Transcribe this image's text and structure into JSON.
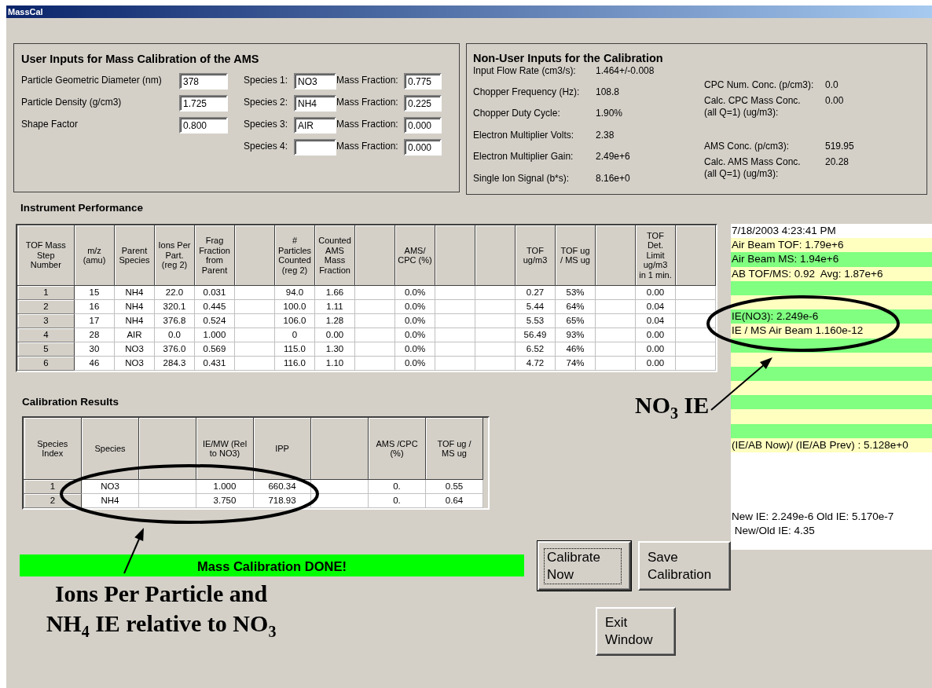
{
  "window": {
    "title": "MassCal"
  },
  "user_inputs": {
    "title": "User Inputs for Mass Calibration of the AMS",
    "particle_fields": [
      {
        "label": "Particle Geometric Diameter (nm)",
        "value": "378"
      },
      {
        "label": "Particle Density (g/cm3)",
        "value": "1.725"
      },
      {
        "label": "Shape Factor",
        "value": "0.800"
      }
    ],
    "species": [
      {
        "label": "Species 1:",
        "value": "NO3",
        "fraction_label": "Mass Fraction:",
        "fraction": "0.775"
      },
      {
        "label": "Species 2:",
        "value": "NH4",
        "fraction_label": "Mass Fraction:",
        "fraction": "0.225"
      },
      {
        "label": "Species 3:",
        "value": "AIR",
        "fraction_label": "Mass Fraction:",
        "fraction": "0.000"
      },
      {
        "label": "Species 4:",
        "fraction_label": "Mass Fraction:",
        "fraction": "0.000"
      }
    ]
  },
  "non_user_inputs": {
    "title": "Non-User Inputs for the Calibration",
    "left": [
      {
        "label": "Input Flow Rate (cm3/s):",
        "value": "1.464+/-0.008"
      },
      {
        "label": "Chopper Frequency (Hz):",
        "value": "108.8"
      },
      {
        "label": "Chopper Duty Cycle:",
        "value": "1.90%"
      },
      {
        "label": "Electron Multiplier Volts:",
        "value": "2.38"
      },
      {
        "label": "Electron Multiplier Gain:",
        "value": "2.49e+6"
      },
      {
        "label": "Single Ion Signal (b*s):",
        "value": "8.16e+0"
      }
    ],
    "right": [
      {
        "label": "CPC Num. Conc. (p/cm3):",
        "value": "0.0"
      },
      {
        "label": "Calc. CPC Mass Conc.\n(all Q=1) (ug/m3):",
        "value": "0.00"
      },
      {
        "label": "AMS Conc. (p/cm3):",
        "value": "519.95"
      },
      {
        "label": "Calc. AMS Mass Conc.\n(all Q=1) (ug/m3):",
        "value": "20.28"
      }
    ]
  },
  "instrument_performance": {
    "title": "Instrument Performance",
    "columns": [
      "TOF Mass\nStep\nNumber",
      "m/z\n(amu)",
      "Parent\nSpecies",
      "Ions Per\nPart.\n(reg 2)",
      "Frag\nFraction\nfrom\nParent",
      null,
      "#\nParticles\nCounted\n(reg 2)",
      "Counted\nAMS\nMass\nFraction",
      null,
      "AMS/\nCPC (%)",
      null,
      null,
      "TOF\nug/m3",
      "TOF ug\n/ MS ug",
      null,
      "TOF\nDet.\nLimit\nug/m3\nin 1 min.",
      null
    ],
    "rows": [
      [
        "1",
        "15",
        "NH4",
        "22.0",
        "0.031",
        null,
        "94.0",
        "1.66",
        null,
        "0.0%",
        null,
        null,
        "0.27",
        "53%",
        null,
        "0.00",
        null
      ],
      [
        "2",
        "16",
        "NH4",
        "320.1",
        "0.445",
        null,
        "100.0",
        "1.11",
        null,
        "0.0%",
        null,
        null,
        "5.44",
        "64%",
        null,
        "0.04",
        null
      ],
      [
        "3",
        "17",
        "NH4",
        "376.8",
        "0.524",
        null,
        "106.0",
        "1.28",
        null,
        "0.0%",
        null,
        null,
        "5.53",
        "65%",
        null,
        "0.04",
        null
      ],
      [
        "4",
        "28",
        "AIR",
        "0.0",
        "1.000",
        null,
        "0",
        "0.00",
        null,
        "0.0%",
        null,
        null,
        "56.49",
        "93%",
        null,
        "0.00",
        null
      ],
      [
        "5",
        "30",
        "NO3",
        "376.0",
        "0.569",
        null,
        "115.0",
        "1.30",
        null,
        "0.0%",
        null,
        null,
        "6.52",
        "46%",
        null,
        "0.00",
        null
      ],
      [
        "6",
        "46",
        "NO3",
        "284.3",
        "0.431",
        null,
        "116.0",
        "1.10",
        null,
        "0.0%",
        null,
        null,
        "4.72",
        "74%",
        null,
        "0.00",
        null
      ]
    ]
  },
  "calibration_results": {
    "title": "Calibration Results",
    "columns": [
      "Species\nIndex",
      "Species",
      null,
      "IE/MW (Rel\nto NO3)",
      "IPP",
      null,
      "AMS /CPC\n(%)",
      "TOF ug /\nMS ug"
    ],
    "rows": [
      [
        "1",
        "NO3",
        null,
        "1.000",
        "660.34",
        null,
        "0.",
        "0.55"
      ],
      [
        "2",
        "NH4",
        null,
        "3.750",
        "718.93",
        null,
        "0.",
        "0.64"
      ]
    ]
  },
  "status": {
    "text": "Mass Calibration DONE!"
  },
  "buttons": [
    {
      "label": "Calibrate Now",
      "default": true
    },
    {
      "label": "Save Calibration",
      "default": false
    },
    {
      "label": "Exit Window",
      "default": false
    }
  ],
  "log": {
    "lines": [
      {
        "kind": "plain",
        "text": "7/18/2003 4:23:41 PM"
      },
      {
        "kind": "striped",
        "text": "Air Beam TOF: 1.79e+6"
      },
      {
        "kind": "striped",
        "text": "Air Beam MS: 1.94e+6"
      },
      {
        "kind": "striped",
        "text": "AB TOF/MS: 0.92  Avg: 1.87e+6"
      },
      {
        "kind": "striped"
      },
      {
        "kind": "striped"
      },
      {
        "kind": "striped",
        "text": "IE(NO3): 2.249e-6"
      },
      {
        "kind": "striped",
        "text": "IE / MS Air Beam 1.160e-12"
      },
      {
        "kind": "striped"
      },
      {
        "kind": "striped"
      },
      {
        "kind": "striped"
      },
      {
        "kind": "striped"
      },
      {
        "kind": "striped"
      },
      {
        "kind": "striped"
      },
      {
        "kind": "striped"
      },
      {
        "kind": "striped",
        "text": "(IE/AB Now)/ (IE/AB Prev) : 5.128e+0"
      },
      {
        "kind": "plain"
      },
      {
        "kind": "plain"
      },
      {
        "kind": "plain"
      },
      {
        "kind": "plain"
      },
      {
        "kind": "plain",
        "text": "New IE: 2.249e-6 Old IE: 5.170e-7"
      },
      {
        "kind": "plain",
        "text": " New/Old IE: 4.35"
      }
    ]
  },
  "annotations": [
    {
      "kind": "callout",
      "text": "NO$_{3}$ IE"
    },
    {
      "kind": "callout",
      "text": "Ions Per Particle and NH$_{4}$ IE relative to NO$_{3}$"
    }
  ]
}
